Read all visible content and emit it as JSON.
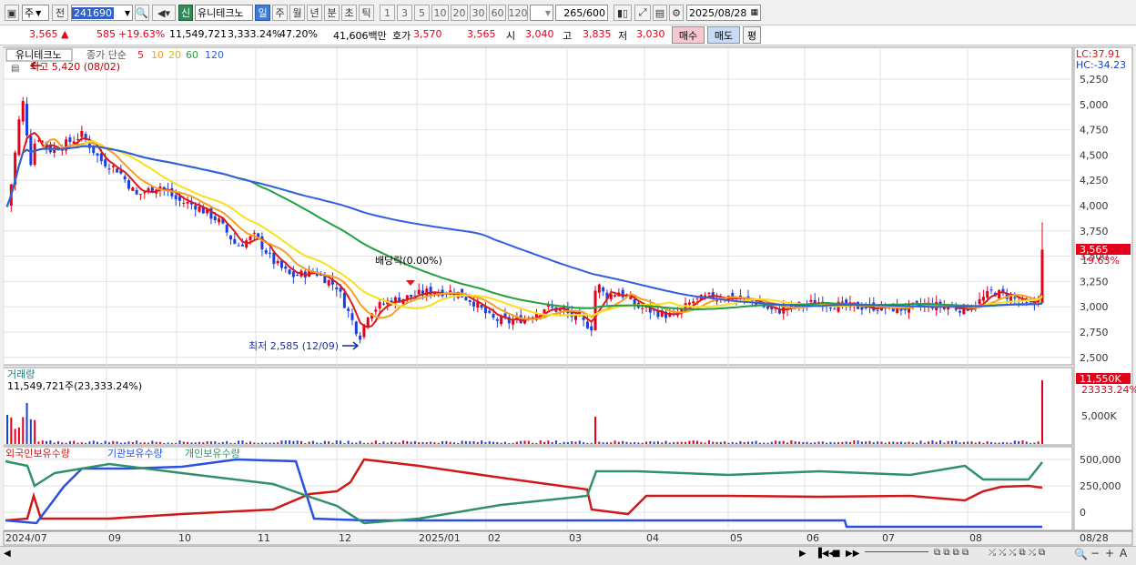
{
  "toolbar": {
    "period_unit": "주",
    "prev_label": "전",
    "code": "241690",
    "stock_name": "유니테크노",
    "new_badge": "신",
    "periods": [
      "일",
      "주",
      "월",
      "년",
      "분",
      "초",
      "틱"
    ],
    "active_period": "일",
    "intervals": [
      "1",
      "3",
      "5",
      "10",
      "20",
      "30",
      "60",
      "120"
    ],
    "count": "265",
    "count_max": "/600",
    "date": "2025/08/28"
  },
  "quote": {
    "price": "3,565",
    "change": "585",
    "change_pct": "+19.63%",
    "volume": "11,549,721",
    "volume_ratio": "3,333.24%",
    "turnover": "47.20%",
    "amount": "41,606백만",
    "bid_label": "호가",
    "ask": "3,570",
    "bid": "3,565",
    "open_label": "시",
    "open": "3,040",
    "high_label": "고",
    "high": "3,835",
    "low_label": "저",
    "low": "3,030",
    "buy_label": "매수",
    "sell_label": "매도",
    "eval_label": "평"
  },
  "price_panel": {
    "legend_name": "유니테크노",
    "legend_ma": "종가 단순",
    "ma_periods": [
      "5",
      "10",
      "20",
      "60",
      "120"
    ],
    "high_note": "최고 5,420 (08/02)",
    "low_note": "최저 2,585 (12/09)",
    "dividend_note": "배당락(0.00%)",
    "lc": "LC:37.91",
    "hc": "HC:-34.23",
    "last_price": "3,565",
    "last_pct": "19.63%"
  },
  "volume_panel": {
    "title": "거래량",
    "value": "11,549,721주(23,333.24%)",
    "last_tag": "11,550K",
    "last_pct": "23333.24%"
  },
  "holding_panel": {
    "titles": [
      "외국인보유수량",
      "기관보유수량",
      "개인보유수량"
    ]
  },
  "x_axis": [
    "2024/07",
    "09",
    "10",
    "11",
    "12",
    "2025/01",
    "02",
    "03",
    "04",
    "05",
    "06",
    "07",
    "08",
    "08/28"
  ],
  "colors": {
    "up": "#e4001a",
    "down": "#1c3fe0",
    "ma5": "#e01818",
    "ma10": "#f5a020",
    "ma20": "#f8e020",
    "ma60": "#22a040",
    "ma120": "#3060e0",
    "foreign": "#d01818",
    "inst": "#2a50e0",
    "indiv": "#30906a"
  },
  "chart_data": [
    {
      "type": "line",
      "title": "유니테크노 종가 단순",
      "y_ticks": [
        5250,
        5000,
        4750,
        4500,
        4250,
        4000,
        3750,
        3500,
        3250,
        3000,
        2750,
        2500
      ],
      "ylim": [
        2410,
        5540
      ],
      "x_months": [
        "2024/07",
        "09",
        "10",
        "11",
        "12",
        "2025/01",
        "02",
        "03",
        "04",
        "05",
        "06",
        "07",
        "08"
      ],
      "close_monthly": [
        {
          "month": "2024/07",
          "close": 4600
        },
        {
          "month": "2024/08",
          "close": 4550
        },
        {
          "month": "2024/09",
          "close": 4150
        },
        {
          "month": "2024/10",
          "close": 3700
        },
        {
          "month": "2024/11",
          "close": 3250
        },
        {
          "month": "2024/12",
          "close": 3050
        },
        {
          "month": "2025/01",
          "close": 3120
        },
        {
          "month": "2025/02",
          "close": 2850
        },
        {
          "month": "2025/03",
          "close": 3050
        },
        {
          "month": "2025/04",
          "close": 2950
        },
        {
          "month": "2025/05",
          "close": 3050
        },
        {
          "month": "2025/06",
          "close": 2980
        },
        {
          "month": "2025/07",
          "close": 3000
        },
        {
          "month": "2025/08",
          "close": 3565
        }
      ],
      "series": [
        {
          "name": "5"
        },
        {
          "name": "10"
        },
        {
          "name": "20"
        },
        {
          "name": "60"
        },
        {
          "name": "120"
        }
      ],
      "annotations": [
        {
          "text": "최고 5,420 (08/02)",
          "value": 5420
        },
        {
          "text": "최저 2,585 (12/09)",
          "value": 2585
        }
      ]
    },
    {
      "type": "bar",
      "title": "거래량",
      "y_ticks": [
        5000
      ],
      "unit": "K",
      "last_value": 11550
    },
    {
      "type": "line",
      "series": [
        {
          "name": "외국인보유수량"
        },
        {
          "name": "기관보유수량"
        },
        {
          "name": "개인보유수량"
        }
      ],
      "y_ticks": [
        500000,
        250000,
        0
      ]
    }
  ]
}
